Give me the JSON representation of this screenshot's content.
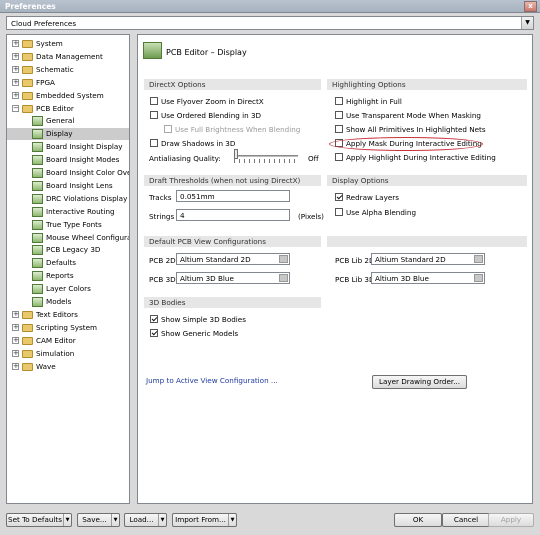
{
  "window": {
    "title": "Preferences",
    "close_glyph": "x"
  },
  "combo": {
    "value": "Cloud Preferences",
    "arrow_glyph": "▼"
  },
  "tree": {
    "nodes": [
      {
        "label": "System",
        "expander": "+",
        "kind": "folder"
      },
      {
        "label": "Data Management",
        "expander": "+",
        "kind": "folder"
      },
      {
        "label": "Schematic",
        "expander": "+",
        "kind": "folder"
      },
      {
        "label": "FPGA",
        "expander": "+",
        "kind": "folder"
      },
      {
        "label": "Embedded System",
        "expander": "+",
        "kind": "folder"
      },
      {
        "label": "PCB Editor",
        "expander": "−",
        "kind": "folder"
      },
      {
        "label": "General",
        "kind": "page"
      },
      {
        "label": "Display",
        "kind": "page",
        "selected": true
      },
      {
        "label": "Board Insight Display",
        "kind": "page"
      },
      {
        "label": "Board Insight Modes",
        "kind": "page"
      },
      {
        "label": "Board Insight Color Overrid",
        "kind": "page"
      },
      {
        "label": "Board Insight Lens",
        "kind": "page"
      },
      {
        "label": "DRC Violations Display",
        "kind": "page"
      },
      {
        "label": "Interactive Routing",
        "kind": "page"
      },
      {
        "label": "True Type Fonts",
        "kind": "page"
      },
      {
        "label": "Mouse Wheel Configuration",
        "kind": "page"
      },
      {
        "label": "PCB Legacy 3D",
        "kind": "page"
      },
      {
        "label": "Defaults",
        "kind": "page"
      },
      {
        "label": "Reports",
        "kind": "page"
      },
      {
        "label": "Layer Colors",
        "kind": "page"
      },
      {
        "label": "Models",
        "kind": "page"
      },
      {
        "label": "Text Editors",
        "expander": "+",
        "kind": "folder"
      },
      {
        "label": "Scripting System",
        "expander": "+",
        "kind": "folder"
      },
      {
        "label": "CAM Editor",
        "expander": "+",
        "kind": "folder"
      },
      {
        "label": "Simulation",
        "expander": "+",
        "kind": "folder"
      },
      {
        "label": "Wave",
        "expander": "+",
        "kind": "folder"
      }
    ]
  },
  "panel": {
    "title": "PCB Editor – Display",
    "directx": {
      "header": "DirectX Options",
      "flyover": {
        "label": "Use Flyover Zoom in DirectX",
        "checked": false
      },
      "ordered": {
        "label": "Use Ordered Blending in 3D",
        "checked": false
      },
      "full_brightness": {
        "label": "Use Full Brightness When Blending",
        "checked": false
      },
      "shadows": {
        "label": "Draw Shadows in 3D",
        "checked": false
      },
      "antialiasing_label": "Antialiasing Quality:",
      "antialiasing_value_label": "Off",
      "antialiasing_level": 0
    },
    "highlighting": {
      "header": "Highlighting Options",
      "full": {
        "label": "Highlight in Full",
        "checked": false
      },
      "transparent": {
        "label": "Use Transparent Mode When Masking",
        "checked": false
      },
      "show_all": {
        "label": "Show All Primitives In Highlighted Nets",
        "checked": false
      },
      "apply_mask": {
        "label": "Apply Mask During Interactive Editing",
        "checked": false
      },
      "apply_highlight": {
        "label": "Apply Highlight During Interactive Editing",
        "checked": false
      }
    },
    "draft": {
      "header": "Draft Thresholds (when not using DirectX)",
      "tracks_label": "Tracks",
      "tracks_value": "0.051mm",
      "strings_label": "Strings",
      "strings_value": "4",
      "strings_unit": "(Pixels)"
    },
    "display_options": {
      "header": "Display Options",
      "redraw": {
        "label": "Redraw Layers",
        "checked": true
      },
      "alpha": {
        "label": "Use Alpha Blending",
        "checked": false
      }
    },
    "default_views": {
      "header": "Default PCB View Configurations",
      "pcb2d_label": "PCB 2D",
      "pcb2d_value": "Altium Standard 2D",
      "pcb3d_label": "PCB 3D",
      "pcb3d_value": "Altium 3D Blue",
      "lib2d_label": "PCB Lib 2D",
      "lib2d_value": "Altium Standard 2D",
      "lib3d_label": "PCB Lib 3D",
      "lib3d_value": "Altium 3D Blue"
    },
    "bodies": {
      "header": "3D Bodies",
      "simple": {
        "label": "Show Simple 3D Bodies",
        "checked": true
      },
      "generic": {
        "label": "Show Generic Models",
        "checked": true
      }
    },
    "jump_link": "Jump to Active View Configuration ...",
    "layer_button": "Layer Drawing Order..."
  },
  "footer": {
    "defaults": "Set To Defaults",
    "save": "Save...",
    "load": "Load...",
    "import": "Import From...",
    "ok": "OK",
    "cancel": "Cancel",
    "apply": "Apply",
    "caret_glyph": "▼"
  },
  "colors": {
    "highlight_circle": "#c8323c",
    "selection": "#cccccc",
    "link": "#1f3a9e"
  }
}
